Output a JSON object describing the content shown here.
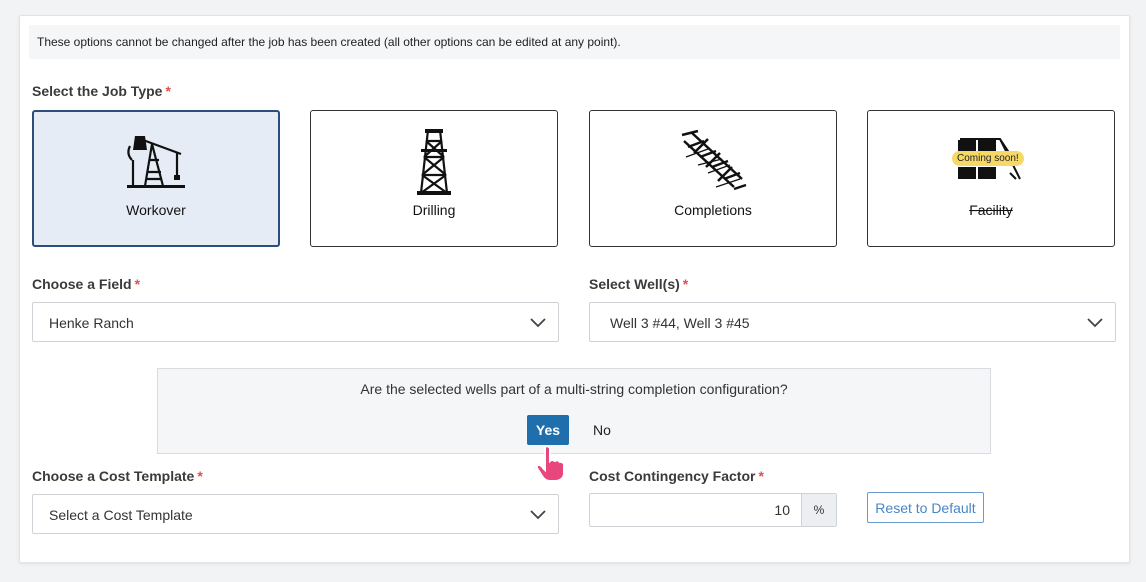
{
  "notice": "These options cannot be changed after the job has been created (all other options can be edited at any point).",
  "job_type": {
    "label": "Select the Job Type",
    "required_mark": "*",
    "options": [
      {
        "label": "Workover",
        "icon": "pumpjack-icon",
        "selected": true
      },
      {
        "label": "Drilling",
        "icon": "drilling-rig-icon",
        "selected": false
      },
      {
        "label": "Completions",
        "icon": "completions-icon",
        "selected": false
      },
      {
        "label": "Facility",
        "icon": "facility-icon",
        "selected": false,
        "disabled": true,
        "badge": "Coming soon!"
      }
    ]
  },
  "field": {
    "label": "Choose a Field",
    "required_mark": "*",
    "value": "Henke Ranch"
  },
  "wells": {
    "label": "Select Well(s)",
    "required_mark": "*",
    "value": "Well 3 #44, Well 3 #45"
  },
  "multi_string": {
    "question": "Are the selected wells part of a multi-string completion configuration?",
    "yes_label": "Yes",
    "no_label": "No"
  },
  "cost_template": {
    "label": "Choose a Cost Template",
    "required_mark": "*",
    "placeholder": "Select a Cost Template"
  },
  "contingency": {
    "label": "Cost Contingency Factor",
    "required_mark": "*",
    "value": "10",
    "unit": "%",
    "reset_label": "Reset to Default"
  },
  "colors": {
    "accent": "#1f6fad",
    "selected_tile_bg": "#e5ecf6",
    "badge": "#f6d867",
    "required": "#d9534f"
  }
}
